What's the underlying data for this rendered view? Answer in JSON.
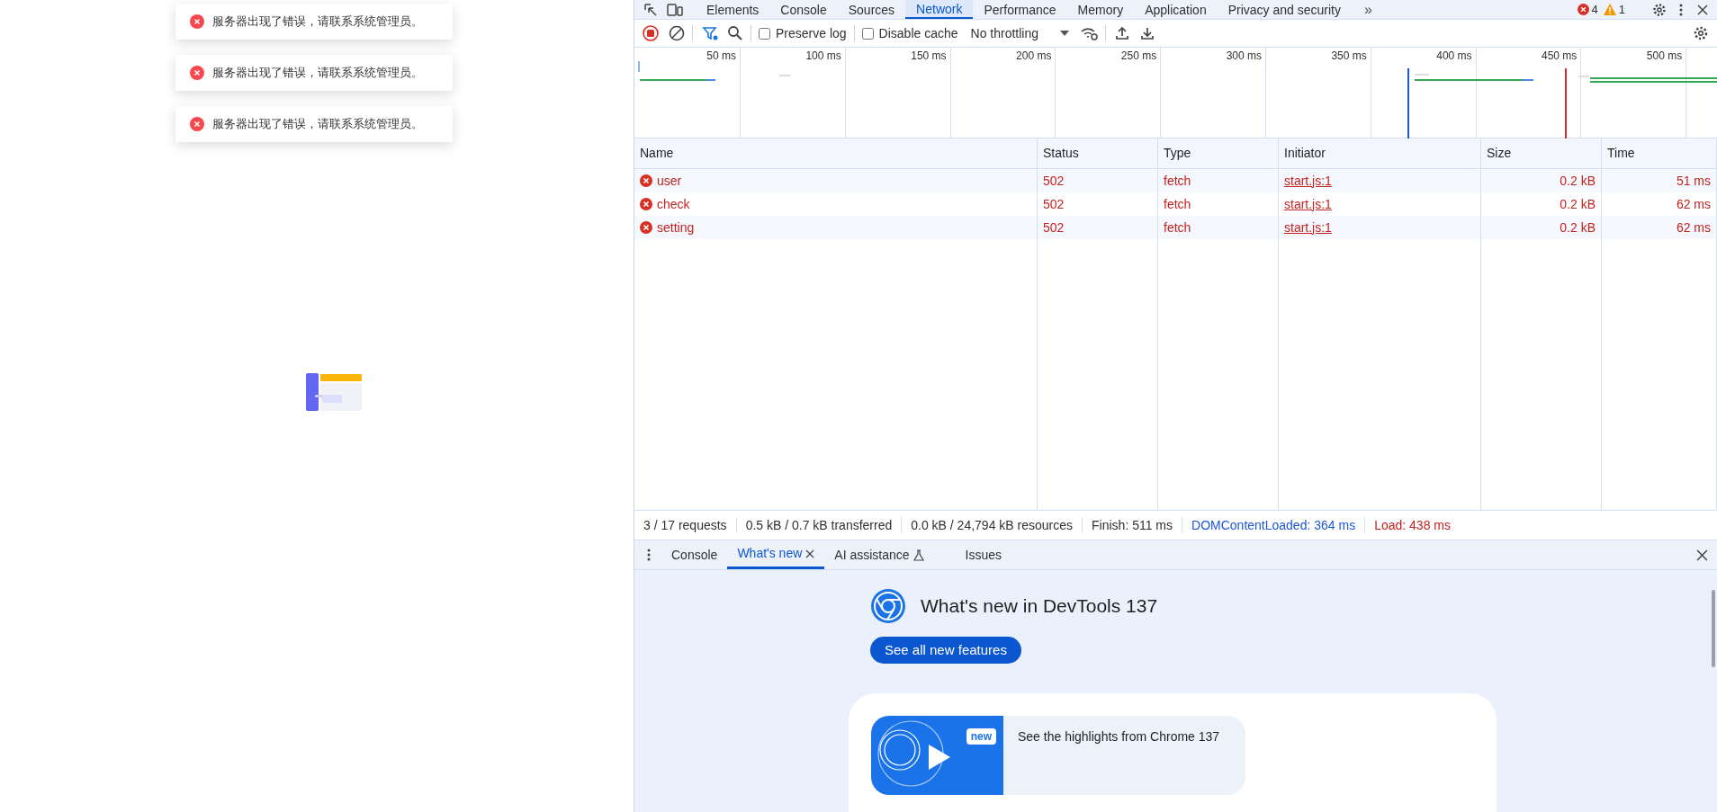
{
  "page": {
    "toasts": [
      {
        "kind": "error",
        "message": "服务器出现了错误，请联系系统管理员。"
      },
      {
        "kind": "error",
        "message": "服务器出现了错误，请联系系统管理员。"
      },
      {
        "kind": "error",
        "message": "服务器出现了错误，请联系系统管理员。"
      }
    ]
  },
  "devtools": {
    "tabs": [
      {
        "label": "Elements",
        "selected": false
      },
      {
        "label": "Console",
        "selected": false
      },
      {
        "label": "Sources",
        "selected": false
      },
      {
        "label": "Network",
        "selected": true
      },
      {
        "label": "Performance",
        "selected": false
      },
      {
        "label": "Memory",
        "selected": false
      },
      {
        "label": "Application",
        "selected": false
      },
      {
        "label": "Privacy and security",
        "selected": false
      }
    ],
    "more_tabs": "»",
    "error_count": "4",
    "warning_count": "1",
    "toolbar": {
      "recording": true,
      "filter_active": true,
      "preserve_log": {
        "label": "Preserve log",
        "checked": false
      },
      "disable_cache": {
        "label": "Disable cache",
        "checked": false
      },
      "throttling": "No throttling"
    },
    "timeline": {
      "ticks": [
        "50 ms",
        "100 ms",
        "150 ms",
        "200 ms",
        "250 ms",
        "300 ms",
        "350 ms",
        "400 ms",
        "450 ms",
        "500 ms"
      ]
    },
    "table": {
      "columns": [
        "Name",
        "Status",
        "Type",
        "Initiator",
        "Size",
        "Time"
      ],
      "rows": [
        {
          "error": true,
          "name": "user",
          "status": "502",
          "type": "fetch",
          "initiator": "start.js:1",
          "size": "0.2 kB",
          "time": "51 ms"
        },
        {
          "error": true,
          "name": "check",
          "status": "502",
          "type": "fetch",
          "initiator": "start.js:1",
          "size": "0.2 kB",
          "time": "62 ms"
        },
        {
          "error": true,
          "name": "setting",
          "status": "502",
          "type": "fetch",
          "initiator": "start.js:1",
          "size": "0.2 kB",
          "time": "62 ms"
        }
      ]
    },
    "status_bar": [
      {
        "text": "3 / 17 requests",
        "color": "#303030"
      },
      {
        "text": "0.5 kB / 0.7 kB transferred",
        "color": "#303030"
      },
      {
        "text": "0.0 kB / 24,794 kB resources",
        "color": "#303030"
      },
      {
        "text": "Finish: 511 ms",
        "color": "#303030"
      },
      {
        "text": "DOMContentLoaded: 364 ms",
        "color": "#1a56d6"
      },
      {
        "text": "Load: 438 ms",
        "color": "#c5221f"
      }
    ],
    "drawer": {
      "tabs": [
        {
          "label": "Console",
          "selected": false,
          "closable": false,
          "kind": "plain"
        },
        {
          "label": "What's new",
          "selected": true,
          "closable": true,
          "kind": "plain"
        },
        {
          "label": "AI assistance",
          "selected": false,
          "closable": false,
          "kind": "experiment"
        },
        {
          "label": "Issues",
          "selected": false,
          "closable": false,
          "kind": "plain"
        }
      ],
      "whats_new": {
        "title": "What's new in DevTools 137",
        "button": "See all new features",
        "video": {
          "badge": "new",
          "caption": "See the highlights from Chrome 137"
        }
      }
    }
  }
}
